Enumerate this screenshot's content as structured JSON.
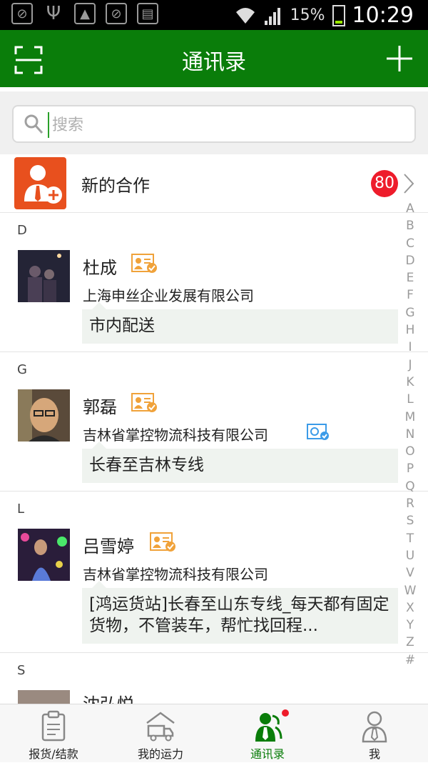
{
  "status_bar": {
    "battery": "15%",
    "time": "10:29"
  },
  "header": {
    "title": "通讯录"
  },
  "search": {
    "placeholder": "搜索"
  },
  "new_cooperation": {
    "label": "新的合作",
    "badge": "80"
  },
  "sections": [
    "D",
    "G",
    "L",
    "S"
  ],
  "contacts": [
    {
      "name": "杜成",
      "company": "上海申丝企业发展有限公司",
      "message": "市内配送"
    },
    {
      "name": "郭磊",
      "company": "吉林省掌控物流科技有限公司",
      "message": "长春至吉林专线"
    },
    {
      "name": "吕雪婷",
      "company": "吉林省掌控物流科技有限公司",
      "message": "[鸿运货站]长春至山东专线_每天都有固定货物，不管装车，帮忙找回程..."
    },
    {
      "name": "沈弘悦"
    }
  ],
  "index_letters": [
    "A",
    "B",
    "C",
    "D",
    "E",
    "F",
    "G",
    "H",
    "I",
    "J",
    "K",
    "L",
    "M",
    "N",
    "O",
    "P",
    "Q",
    "R",
    "S",
    "T",
    "U",
    "V",
    "W",
    "X",
    "Y",
    "Z",
    "#"
  ],
  "tabs": [
    {
      "label": "报货/结款",
      "icon": "clipboard-icon"
    },
    {
      "label": "我的运力",
      "icon": "truck-icon"
    },
    {
      "label": "通讯录",
      "icon": "contacts-icon",
      "active": true,
      "notification_dot": true
    },
    {
      "label": "我",
      "icon": "profile-icon"
    }
  ],
  "colors": {
    "brand_green": "#0a7d0a",
    "badge_red": "#ee1c2b",
    "new_coop_orange": "#e8501e",
    "verify_orange": "#f0a23a",
    "verify_blue": "#3b9be8"
  }
}
